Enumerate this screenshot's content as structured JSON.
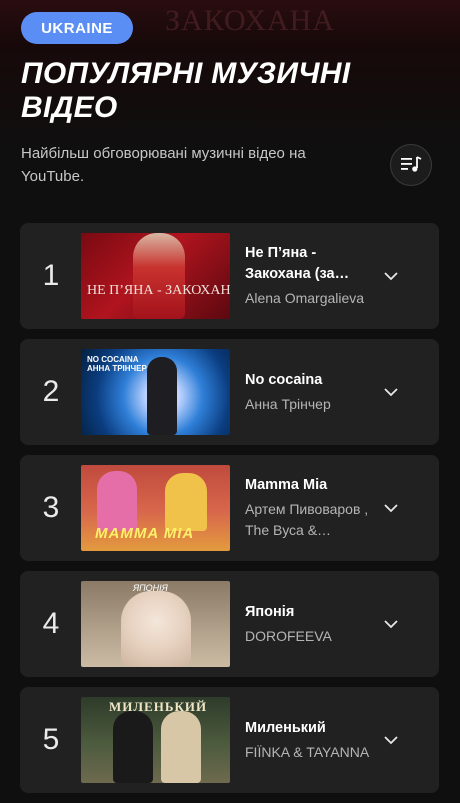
{
  "header": {
    "country": "UKRAINE",
    "background_text": "ЗАКОХАНА",
    "title": "ПОПУЛЯРНІ МУЗИЧНІ ВІДЕО",
    "description": "Найбільш обговорювані музичні відео на YouTube.",
    "playlist_icon": "playlist-add-icon"
  },
  "videos": [
    {
      "rank": "1",
      "title": "Не П’яна - Закохана (за…",
      "artist": "Alena Omargalieva",
      "thumb_text": "НЕ П’ЯНА - ЗАКОХАНА"
    },
    {
      "rank": "2",
      "title": "No cocaina",
      "artist": "Анна Трінчер",
      "thumb_text": "NO COCAINA АННА ТРІНЧЕР"
    },
    {
      "rank": "3",
      "title": "Mamma Mia",
      "artist": "Артем Пивоваров , The Вуса &…",
      "thumb_text": "MAMMA MIA"
    },
    {
      "rank": "4",
      "title": "Японія",
      "artist": "DOROFEEVA",
      "thumb_text": "ЯПОНІЯ"
    },
    {
      "rank": "5",
      "title": "Миленький",
      "artist": "FIЇNKA & TAYANNA",
      "thumb_text": "МИЛЕНЬКИЙ"
    }
  ],
  "colors": {
    "chip": "#5b8ef5",
    "card": "#212121",
    "background": "#0f0f0f"
  }
}
